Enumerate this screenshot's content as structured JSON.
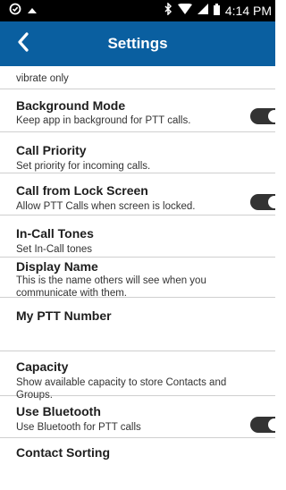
{
  "status_bar": {
    "time": "4:14 PM",
    "icons": [
      "notification-icon",
      "triangle-icon",
      "bluetooth-icon",
      "wifi-icon",
      "signal-icon",
      "battery-icon"
    ]
  },
  "header": {
    "title": "Settings",
    "back_icon": "chevron-left-icon",
    "color": "#0a5fa0"
  },
  "partial_row": {
    "description": "vibrate only"
  },
  "settings": [
    {
      "title": "Background Mode",
      "description": "Keep app in background for PTT calls.",
      "toggle": true,
      "toggle_on": true
    },
    {
      "title": "Call Priority",
      "description": "Set priority for incoming calls.",
      "toggle": false
    },
    {
      "title": "Call from Lock Screen",
      "description": "Allow PTT Calls when screen is locked.",
      "toggle": true,
      "toggle_on": true
    },
    {
      "title": "In-Call Tones",
      "description": "Set In-Call tones",
      "toggle": false
    },
    {
      "title": "Display Name",
      "description": "This is the name others will see when you communicate with them.",
      "toggle": false
    },
    {
      "title": "My PTT Number",
      "description": "",
      "toggle": false
    },
    {
      "title": "Capacity",
      "description": "Show available capacity to store Contacts and Groups.",
      "toggle": false
    },
    {
      "title": "Use Bluetooth",
      "description": "Use Bluetooth for PTT calls",
      "toggle": true,
      "toggle_on": true
    },
    {
      "title": "Contact Sorting",
      "description": "",
      "toggle": false
    }
  ]
}
